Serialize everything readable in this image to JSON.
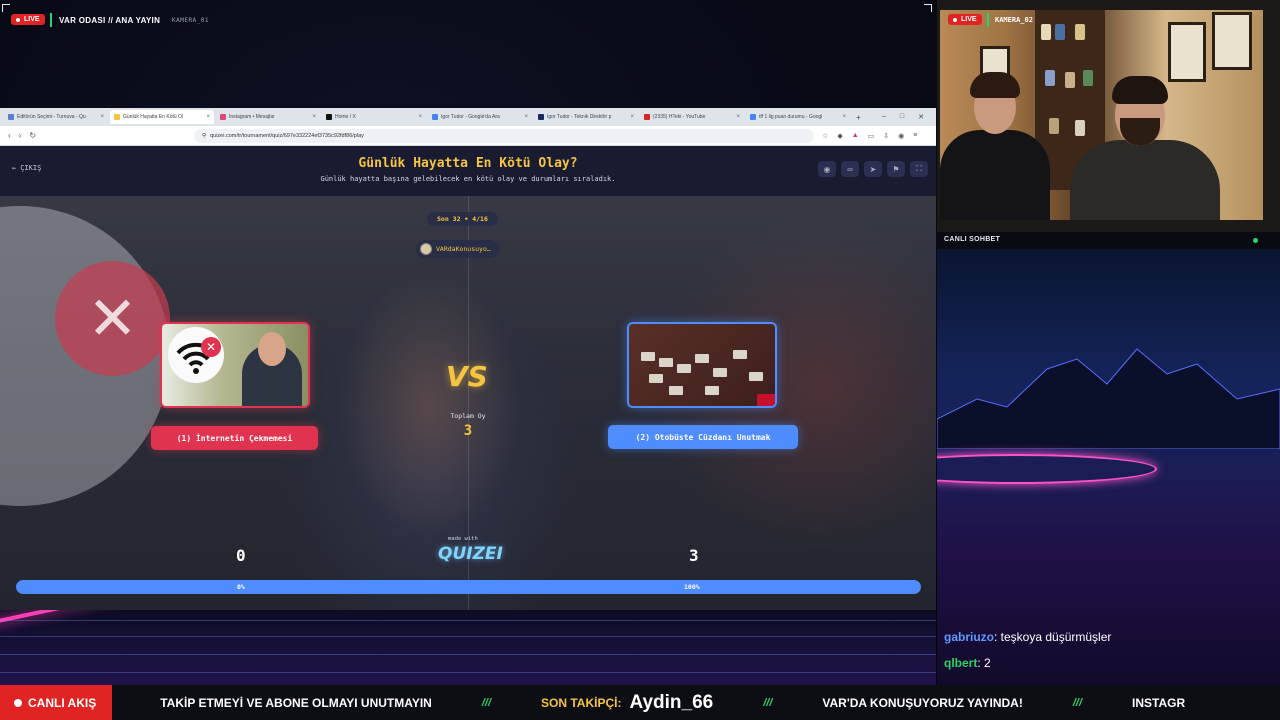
{
  "overlay": {
    "live_label": "LIVE",
    "title": "VAR ODASI // ANA YAYIN",
    "camera1": "KAMERA_01",
    "camera2": "KAMERA_02",
    "chat_title": "CANLI SOHBET"
  },
  "browser": {
    "tabs": [
      {
        "label": "Editörün Seçimi - Turnuva - Qu",
        "color": "#5a7bd8"
      },
      {
        "label": "Günlük Hayatta En Kötü Ol",
        "color": "#f5c542",
        "active": true
      },
      {
        "label": "Instagram • Mesajlar",
        "color": "#e0457b"
      },
      {
        "label": "Home / X",
        "color": "#111111"
      },
      {
        "label": "Igor Tudor - Google'da Ara",
        "color": "#4285f4"
      },
      {
        "label": "Igor Tudor - Teknik Direktör p",
        "color": "#1a2a5a"
      },
      {
        "label": "(2335) HTeki - YouTube",
        "color": "#e02424"
      },
      {
        "label": "tff 1 lig puan durumu - Googl",
        "color": "#4285f4"
      }
    ],
    "url": "quizei.com/tr/tournament/quiz/697e332224ef3735c92fdf86/play"
  },
  "quiz": {
    "exit_label": "ÇIKIŞ",
    "title": "Günlük Hayatta En Kötü Olay?",
    "subtitle": "Günlük hayatta başına gelebilecek en kötü olay ve durumları sıraladık.",
    "round": "Son 32 • 4/16",
    "user": "VARdaKonusuyo…",
    "vs": "VS",
    "total_label": "Toplam Oy",
    "total_votes": "3",
    "left_choice": "(1) İnternetin Çekmemesi",
    "right_choice": "(2) Otobüste Cüzdanı Unutmak",
    "left_score": "0",
    "right_score": "3",
    "made_with": "made with",
    "logo": "QUIZEI",
    "left_pct": "0%",
    "right_pct": "100%",
    "right_share": 1.0
  },
  "chat": {
    "messages": [
      {
        "user": "gabriuzo",
        "color": "#5b9bff",
        "text": ": teşkoya düşürmüşler"
      },
      {
        "user": "qlbert",
        "color": "#2bd46a",
        "text": ": 2"
      }
    ]
  },
  "ticker": {
    "badge": "CANLI AKIŞ",
    "item1": "TAKİP ETMEYİ VE ABONE OLMAYI UNUTMAYIN",
    "sep": "///",
    "follower_label": "SON TAKİPÇİ:",
    "follower_name": "Aydin_66",
    "item2": "VAR'DA KONUŞUYORUZ YAYINDA!",
    "item3": "INSTAGR"
  },
  "colors": {
    "live_red": "#e02424",
    "accent_yellow": "#f5c542",
    "choice_red": "#e0334f",
    "choice_blue": "#4f8cff",
    "status_green": "#2bd46a"
  }
}
